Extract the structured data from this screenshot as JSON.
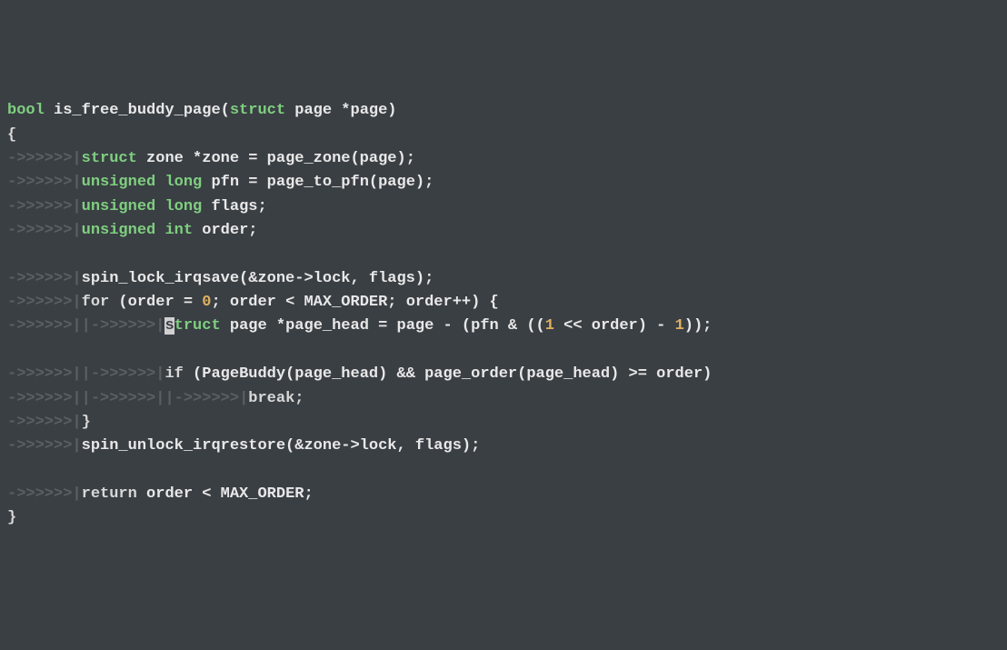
{
  "editor": {
    "tab_indicator_short": "->>>>>>|",
    "tab_indicator_nest": "|->>>>>>|",
    "lines": {
      "l0_bool": "bool",
      "l0_fn": " is_free_buddy_page(",
      "l0_struct": "struct",
      "l0_rest": " page *page)",
      "l1": "{",
      "l2_struct": "struct",
      "l2_zone": " zone *zone = page_zone(page);",
      "l3_unsigned": "unsigned",
      "l3_long": " long",
      "l3_rest": " pfn = page_to_pfn(page);",
      "l4_unsigned": "unsigned",
      "l4_long": " long",
      "l4_rest": " flags;",
      "l5_unsigned": "unsigned",
      "l5_int": " int",
      "l5_rest": " order;",
      "l7": "spin_lock_irqsave(&zone->lock, flags);",
      "l8_for": "for",
      "l8_a": " (order = ",
      "l8_zero": "0",
      "l8_b": "; order < MAX_ORDER; order++) {",
      "l9_cursor": "s",
      "l9_truct": "truct",
      "l9_rest": " page *page_head = page - (pfn & ((",
      "l9_one": "1",
      "l9_mid": " << order) - ",
      "l9_one2": "1",
      "l9_end": "));",
      "l11_if": "if",
      "l11_rest": " (PageBuddy(page_head) && page_order(page_head) >= order)",
      "l12_break": "break",
      "l12_semi": ";",
      "l13": "}",
      "l14": "spin_unlock_irqrestore(&zone->lock, flags);",
      "l16_return": "return",
      "l16_rest": " order < MAX_ORDER;",
      "l17": "}"
    }
  }
}
